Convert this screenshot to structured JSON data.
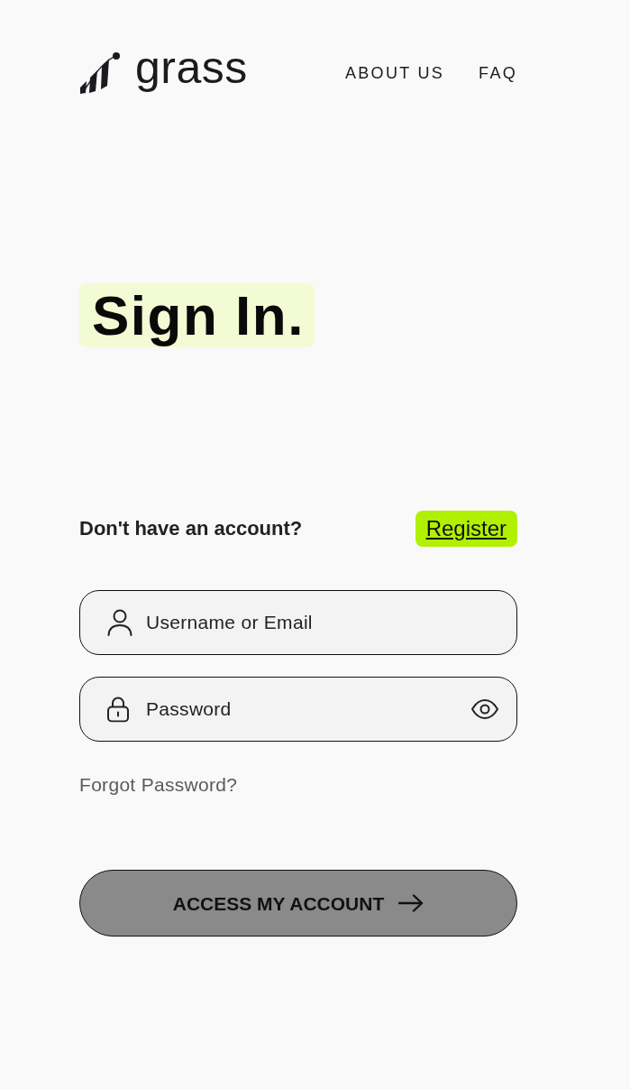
{
  "header": {
    "brand": "grass",
    "nav": [
      {
        "label": "ABOUT US"
      },
      {
        "label": "FAQ"
      }
    ]
  },
  "heading": "Sign In.",
  "register_prompt": {
    "text": "Don't have an account?",
    "link": "Register"
  },
  "fields": [
    {
      "kind": "text",
      "placeholder": "Username or Email"
    },
    {
      "kind": "password",
      "placeholder": "Password"
    }
  ],
  "forgot_link": "Forgot Password?",
  "submit": {
    "label": "ACCESS MY ACCOUNT",
    "disabled": true
  }
}
